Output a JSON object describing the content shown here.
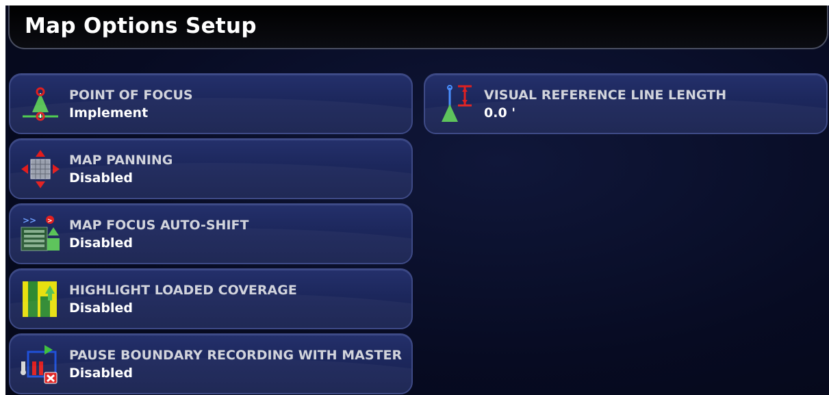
{
  "header": {
    "title": "Map Options Setup"
  },
  "options_left": [
    {
      "label": "POINT OF FOCUS",
      "value": "Implement",
      "icon": "point-of-focus-icon"
    },
    {
      "label": "MAP PANNING",
      "value": "Disabled",
      "icon": "map-panning-icon"
    },
    {
      "label": "MAP FOCUS AUTO-SHIFT",
      "value": "Disabled",
      "icon": "map-focus-auto-shift-icon"
    },
    {
      "label": "HIGHLIGHT LOADED COVERAGE",
      "value": "Disabled",
      "icon": "highlight-coverage-icon"
    },
    {
      "label": "PAUSE BOUNDARY RECORDING WITH MASTER",
      "value": "Disabled",
      "icon": "pause-boundary-icon"
    }
  ],
  "options_right": [
    {
      "label": "VISUAL REFERENCE LINE LENGTH",
      "value": "0.0 '",
      "icon": "reference-line-length-icon"
    }
  ],
  "colors": {
    "background": "#070b22",
    "button": "#1c275c",
    "button_border": "#3e4a86",
    "label": "#d2d4dc",
    "value": "#ffffff"
  }
}
